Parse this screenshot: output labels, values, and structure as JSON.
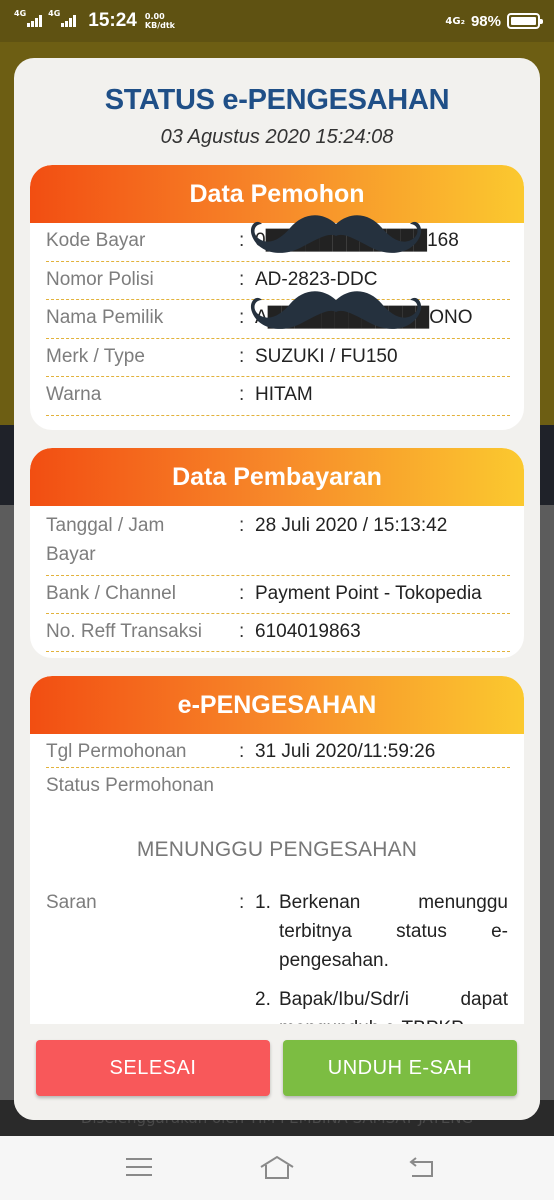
{
  "status_bar": {
    "network1": "4G",
    "network2": "4G",
    "time": "15:24",
    "speed_value": "0.00",
    "speed_unit": "KB/dtk",
    "network3": "4G₂",
    "battery_percent": "98%",
    "battery_level": 0.98
  },
  "modal": {
    "title": "STATUS e-PENGESAHAN",
    "date": "03 Agustus 2020 15:24:08"
  },
  "data_pemohon": {
    "heading": "Data Pemohon",
    "rows": [
      {
        "label": "Kode Bayar",
        "value": "0████████████168"
      },
      {
        "label": "Nomor Polisi",
        "value": "AD-2823-DDC"
      },
      {
        "label": "Nama Pemilik",
        "value": "A████████████ONO"
      },
      {
        "label": "Merk / Type",
        "value": "SUZUKI / FU150"
      },
      {
        "label": "Warna",
        "value": "HITAM"
      }
    ]
  },
  "data_pembayaran": {
    "heading": "Data Pembayaran",
    "rows": [
      {
        "label_line1": "Tanggal / Jam",
        "label_line2": "Bayar",
        "value": "28 Juli 2020 / 15:13:42"
      },
      {
        "label": "Bank / Channel",
        "value": "Payment Point - Tokopedia"
      },
      {
        "label": "No. Reff Transaksi",
        "value": "6104019863"
      }
    ]
  },
  "e_pengesahan": {
    "heading": "e-PENGESAHAN",
    "tgl_label": "Tgl Permohonan",
    "tgl_value": "31 Juli 2020/11:59:26",
    "status_label": "Status Permohonan",
    "status_value": "MENUNGGU PENGESAHAN",
    "saran_label": "Saran",
    "saran_items": [
      {
        "num": "1.",
        "text": "Berkenan menunggu terbitnya status e-pengesahan."
      },
      {
        "num": "2.",
        "text": "Bapak/Ibu/Sdr/i dapat mengunduh e-TBPKP"
      }
    ]
  },
  "separator": ":",
  "buttons": {
    "selesai": "SELESAI",
    "unduh": "UNDUH E-SAH"
  },
  "footer_text": "Diselenggarakan oleh TIM PEMBINA SAMSAT JATENG",
  "colors": {
    "title": "#1f4f87",
    "header_gradient_start": "#f24e12",
    "header_gradient_end": "#fbc92f",
    "selesai": "#f8585a",
    "unduh": "#7cbd42"
  },
  "icons": [
    "signal-icon",
    "battery-icon",
    "mustache-redaction-icon",
    "menu-icon",
    "home-icon",
    "back-icon"
  ]
}
